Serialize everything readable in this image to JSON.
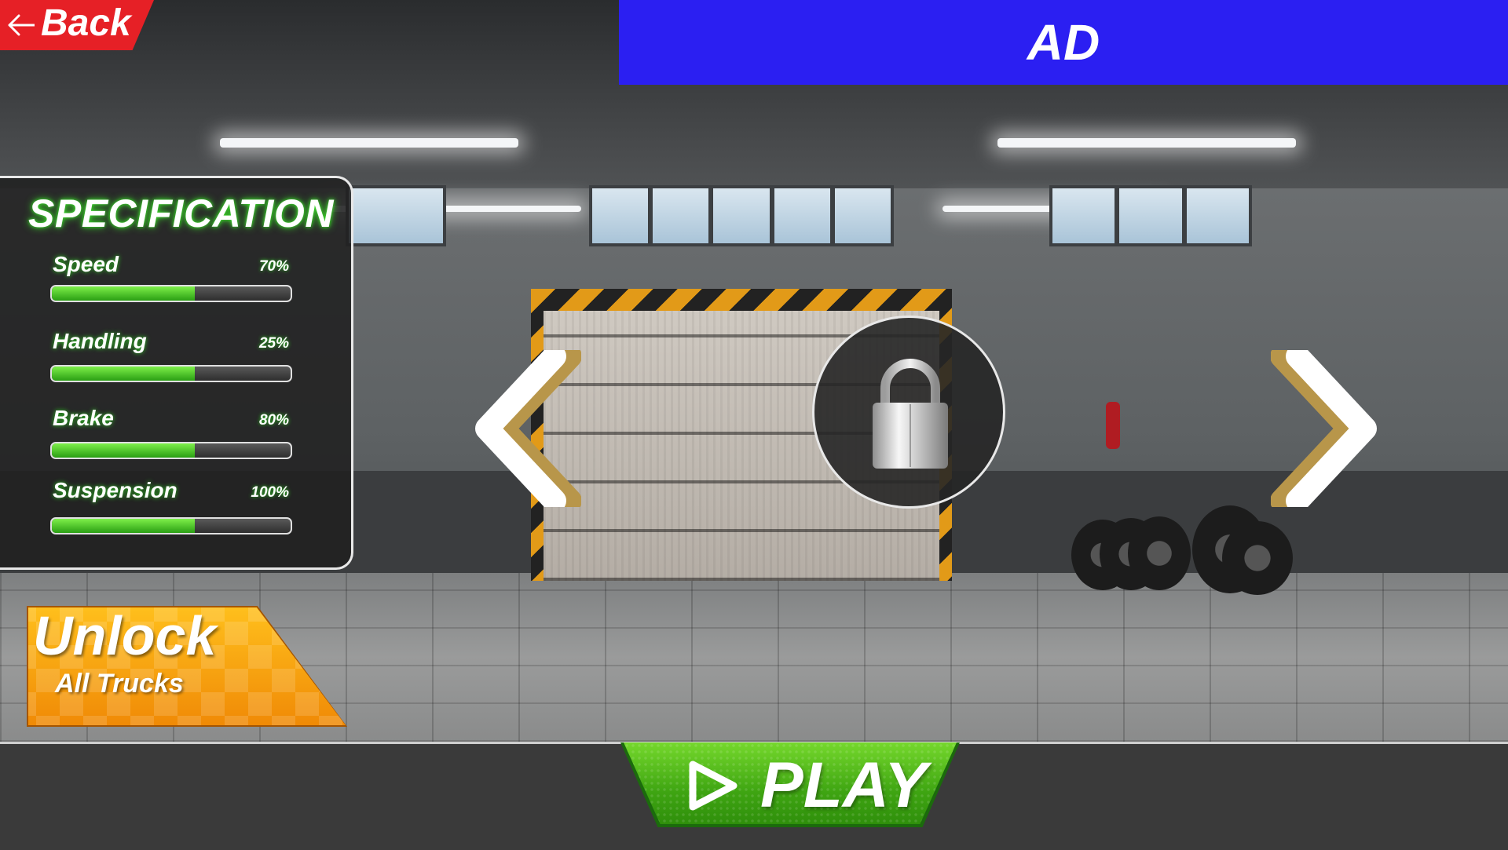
{
  "header": {
    "back_label": "Back",
    "ad_label": "AD"
  },
  "spec_panel": {
    "title": "SPECIFICATION",
    "stats": [
      {
        "name": "Speed",
        "value_text": "70%",
        "fill_fraction": 0.6
      },
      {
        "name": "Handling",
        "value_text": "25%",
        "fill_fraction": 0.6
      },
      {
        "name": "Brake",
        "value_text": "80%",
        "fill_fraction": 0.6
      },
      {
        "name": "Suspension",
        "value_text": "100%",
        "fill_fraction": 0.6
      }
    ]
  },
  "unlock": {
    "title": "Unlock",
    "subtitle": "All Trucks"
  },
  "play": {
    "label": "PLAY"
  },
  "icons": {
    "back": "arrow-left-icon",
    "prev": "chevron-left-icon",
    "next": "chevron-right-icon",
    "lock": "padlock-icon",
    "play": "play-icon"
  },
  "colors": {
    "back_button": "#e62026",
    "ad_banner": "#2b1ff2",
    "stat_bar_fill": "#3fc41a",
    "unlock_button": "#f7a50f",
    "play_button": "#4caf1a",
    "arrow_accent": "#b8964a"
  }
}
